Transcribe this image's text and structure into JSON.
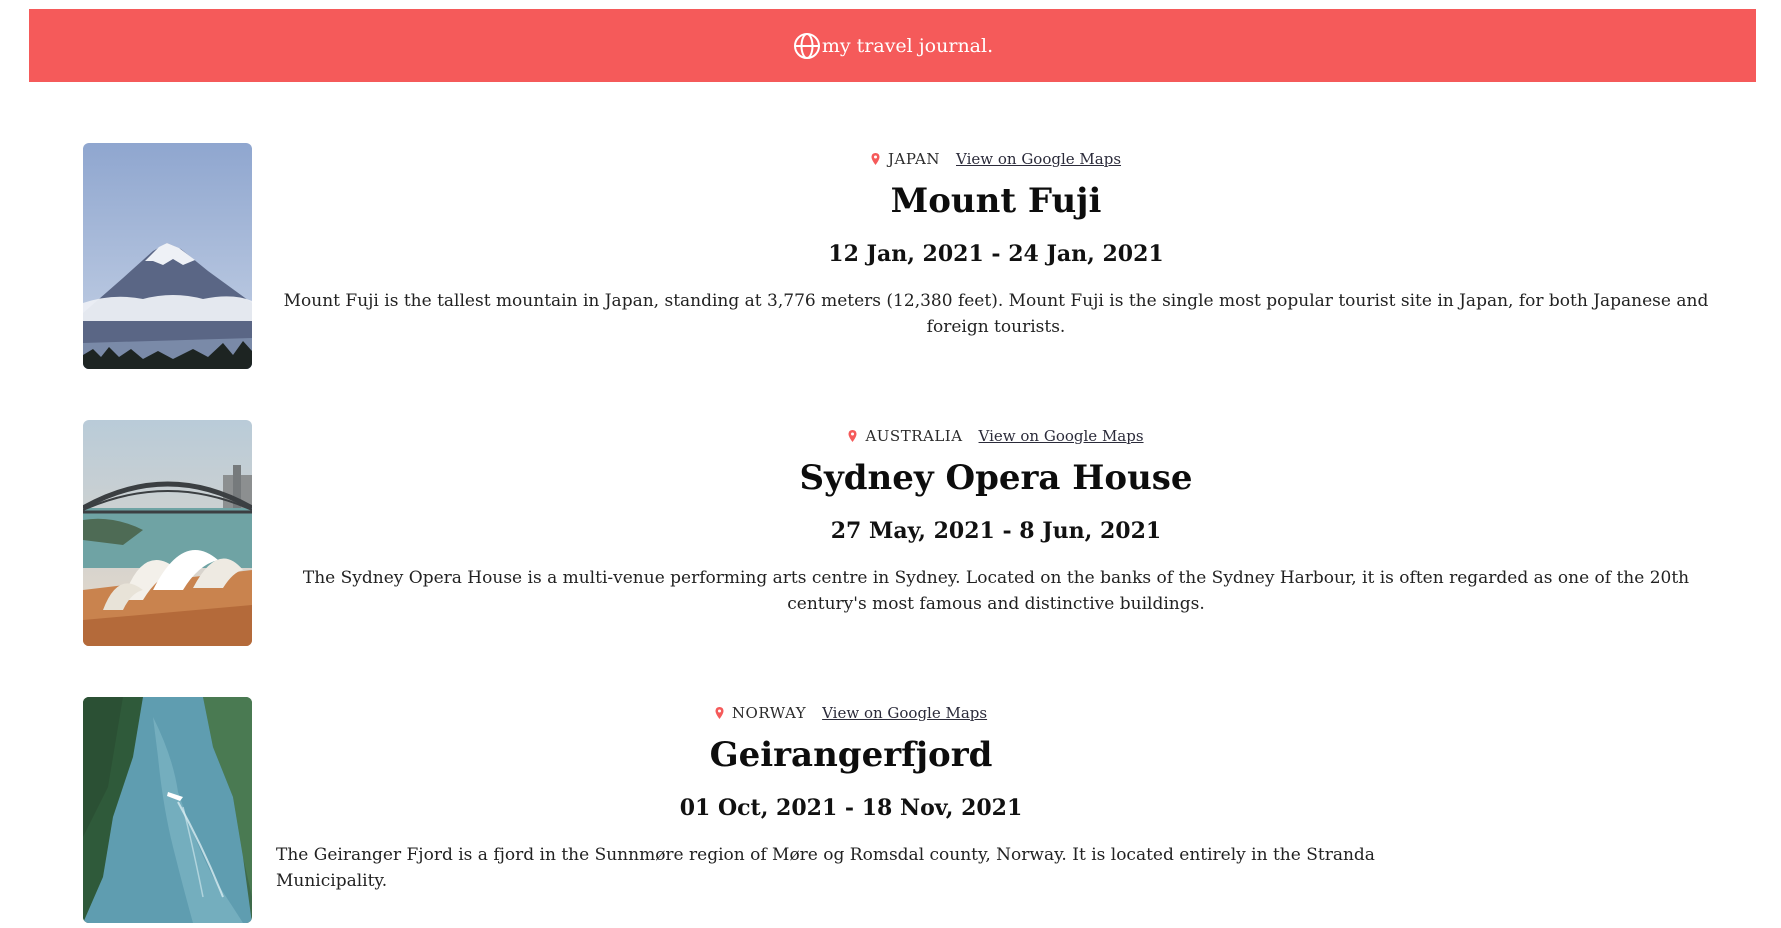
{
  "header": {
    "brand_text": "my travel journal.",
    "icon": "globe-icon",
    "color": "#f55a5a"
  },
  "entries": [
    {
      "country": "JAPAN",
      "maps_link_text": "View on Google Maps",
      "title": "Mount Fuji",
      "dates": "12 Jan, 2021 - 24 Jan, 2021",
      "description": "Mount Fuji is the tallest mountain in Japan, standing at 3,776 meters (12,380 feet). Mount Fuji is the single most popular tourist site in Japan, for both Japanese and foreign tourists."
    },
    {
      "country": "AUSTRALIA",
      "maps_link_text": "View on Google Maps",
      "title": "Sydney Opera House",
      "dates": "27 May, 2021 - 8 Jun, 2021",
      "description": "The Sydney Opera House is a multi-venue performing arts centre in Sydney. Located on the banks of the Sydney Harbour, it is often regarded as one of the 20th century's most famous and distinctive buildings."
    },
    {
      "country": "NORWAY",
      "maps_link_text": "View on Google Maps",
      "title": "Geirangerfjord",
      "dates": "01 Oct, 2021 - 18 Nov, 2021",
      "description": "The Geiranger Fjord is a fjord in the Sunnmøre region of Møre og Romsdal county, Norway. It is located entirely in the Stranda Municipality."
    }
  ],
  "icons": {
    "pin": "location-pin-icon"
  }
}
